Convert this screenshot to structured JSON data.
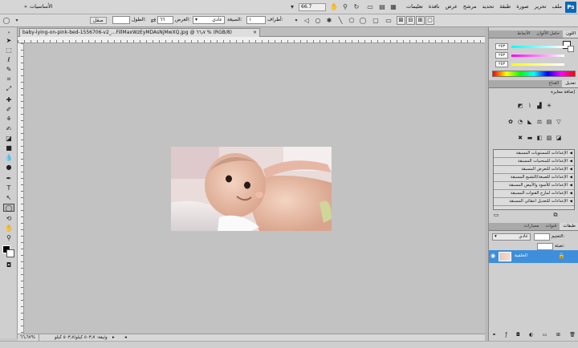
{
  "app": {
    "logo": "Ps"
  },
  "menu": [
    "ملف",
    "تحرير",
    "صورة",
    "طبقة",
    "تحديد",
    "مرشح",
    "عرض",
    "نافذة",
    "تعليمات"
  ],
  "zoom": "66.7",
  "workspace": {
    "label": "الأساسيات",
    "chevron": "»"
  },
  "options": {
    "feather_label": "أطراف:",
    "feather_value": "١",
    "style_label": "الصيغة:",
    "style_value": "عادي",
    "width_label": "العرض:",
    "width_value": "٦٦",
    "height_label": "الطول:",
    "refine_label": "صقل"
  },
  "document": {
    "tab_title": "baby-lying-on-pink-bed-1556706-v2_...FillMaxWzEyMDAsNjMwXQ.jpg @ ٦٦٫٧ % (RGB/8)",
    "close": "×"
  },
  "status": {
    "zoom": "٦٦٫٦٧%",
    "doc_info": "وثيقة: ٥٠٣٫٧ كيلو/٥٠٣٫٧ كيلو"
  },
  "color_panel": {
    "tabs": [
      "اللون",
      "حامل الألوان",
      "الأنماط"
    ],
    "values": [
      "٢٥٣",
      "٢٥٣",
      "٢٥٣"
    ]
  },
  "adjustments": {
    "tabs": [
      "تعديل",
      "القناع"
    ],
    "header": "إضافة معايرة",
    "presets": [
      "الإعدادات للمستويات المسبقة",
      "الإعدادات للمنحنيات المسبقة",
      "الإعدادات للتعرض المسبقة",
      "الإعدادات للصبغة/التشبع المسبقة",
      "الإعدادات للأسود والأبيض المسبقة",
      "الإعدادات لمازج القنوات المسبقة",
      "الإعدادات للتعديل انتقائي المسبقة"
    ]
  },
  "layers": {
    "tabs": [
      "طبقات",
      "قنوات",
      "مسارات"
    ],
    "blend_mode": "عادي",
    "opacity_label": "التعتيم:",
    "fill_label": "تعبئة:",
    "layer_name": "الخلفية"
  },
  "icons": {
    "eye": "eye-icon",
    "lock": "lock-icon",
    "hand": "hand-tool-icon",
    "zoom": "zoom-tool-icon",
    "marquee": "elliptical-marquee-icon"
  },
  "colors": {
    "menubar": "#d6d6d6",
    "canvas_bg": "#c2c2c2",
    "panel_bg": "#cfcfcf",
    "layer_selected": "#3d8fdb",
    "ps_blue": "#0b67b8"
  }
}
